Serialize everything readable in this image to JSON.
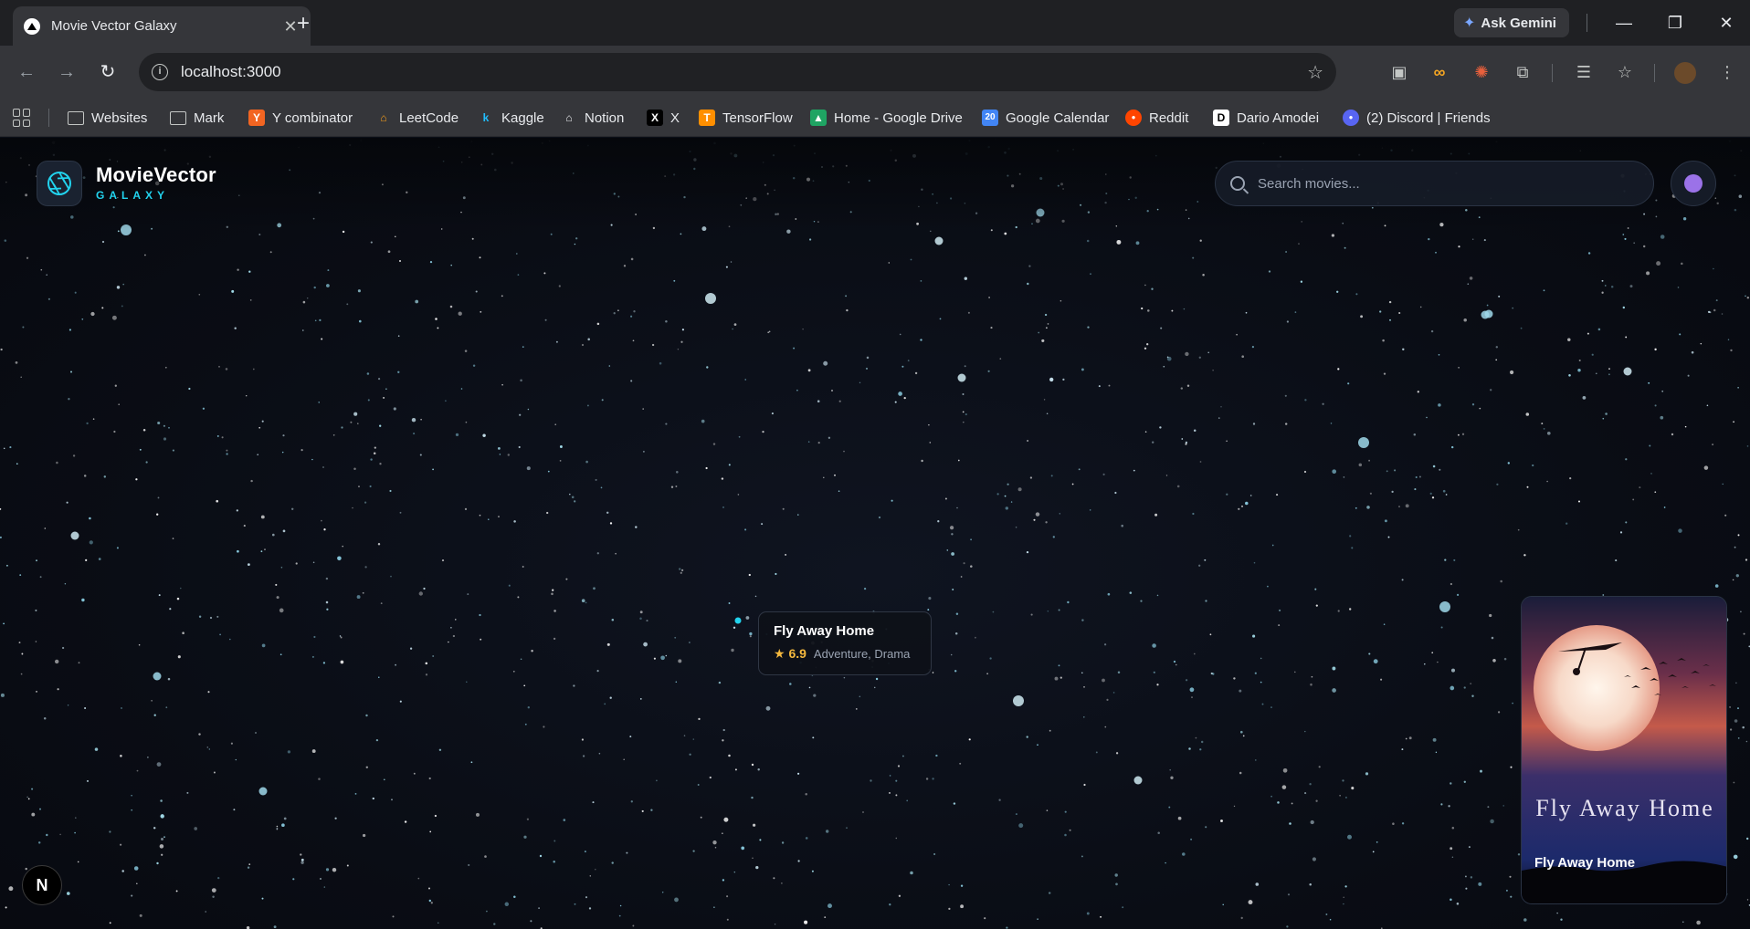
{
  "browser": {
    "tab_title": "Movie Vector Galaxy",
    "tab_close": "✕",
    "new_tab": "+",
    "ask_gemini": "Ask Gemini",
    "url": "localhost:3000",
    "bookmarks": [
      {
        "label": "Websites",
        "icon": "folder-icon"
      },
      {
        "label": "Mark",
        "icon": "folder-icon"
      },
      {
        "label": "Y combinator",
        "icon": "ycombinator-icon",
        "glyph": "Y",
        "color": "#f26522"
      },
      {
        "label": "LeetCode",
        "icon": "leetcode-icon",
        "glyph": "⌂",
        "color": "#f89f1b"
      },
      {
        "label": "Kaggle",
        "icon": "kaggle-icon",
        "glyph": "k",
        "color": "#20beff"
      },
      {
        "label": "Notion",
        "icon": "notion-icon",
        "glyph": "⌂",
        "color": "#e8eaed"
      },
      {
        "label": "X",
        "icon": "x-icon",
        "glyph": "X",
        "color": "#000000"
      },
      {
        "label": "TensorFlow",
        "icon": "tensorflow-icon",
        "glyph": "T",
        "color": "#ff8f00"
      },
      {
        "label": "Home - Google Drive",
        "icon": "google-drive-icon",
        "glyph": "▲",
        "color": "#1fa463"
      },
      {
        "label": "Google Calendar",
        "icon": "google-calendar-icon",
        "glyph": "20",
        "color": "#4285f4"
      },
      {
        "label": "Reddit",
        "icon": "reddit-icon",
        "glyph": "●",
        "color": "#ff4500"
      },
      {
        "label": "Dario Amodei",
        "icon": "dario-amodei-icon",
        "glyph": "D",
        "color": "#ffffff"
      },
      {
        "label": "(2) Discord | Friends",
        "icon": "discord-icon",
        "glyph": "●",
        "color": "#5865f2"
      }
    ]
  },
  "app": {
    "brand_name": "MovieVector",
    "brand_sub": "GALAXY",
    "search_placeholder": "Search movies...",
    "accent": "#22d3ee",
    "avatar_color": "#9b72e8"
  },
  "hover": {
    "title": "Fly Away Home",
    "rating": "★ 6.9",
    "genres": "Adventure, Drama"
  },
  "poster": {
    "art_title": "Fly Away Home",
    "caption": "Fly Away Home"
  },
  "devtools": {
    "label": "N"
  }
}
